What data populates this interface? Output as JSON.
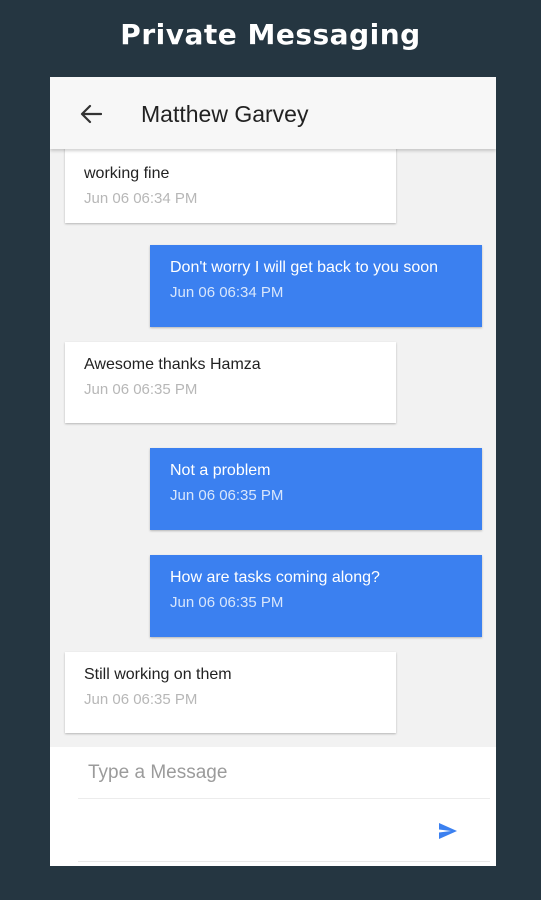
{
  "banner": {
    "title": "Private Messaging"
  },
  "header": {
    "contact_name": "Matthew Garvey",
    "back_icon": "arrow-left-icon"
  },
  "messages": [
    {
      "direction": "incoming",
      "text": "working fine",
      "time": "Jun 06 06:34 PM"
    },
    {
      "direction": "outgoing",
      "text": "Don't worry I will get back to you soon",
      "time": "Jun 06 06:34 PM"
    },
    {
      "direction": "incoming",
      "text": "Awesome thanks Hamza",
      "time": "Jun 06 06:35 PM"
    },
    {
      "direction": "outgoing",
      "text": "Not a problem",
      "time": "Jun 06 06:35 PM"
    },
    {
      "direction": "outgoing",
      "text": "How are tasks coming along?",
      "time": "Jun 06 06:35 PM"
    },
    {
      "direction": "incoming",
      "text": "Still working on them",
      "time": "Jun 06 06:35 PM"
    }
  ],
  "composer": {
    "placeholder": "Type a Message",
    "value": "",
    "send_icon": "send-icon"
  },
  "colors": {
    "background": "#253641",
    "outgoing_bubble": "#3b80f0",
    "incoming_bubble": "#ffffff",
    "send_icon": "#3b80f0"
  }
}
